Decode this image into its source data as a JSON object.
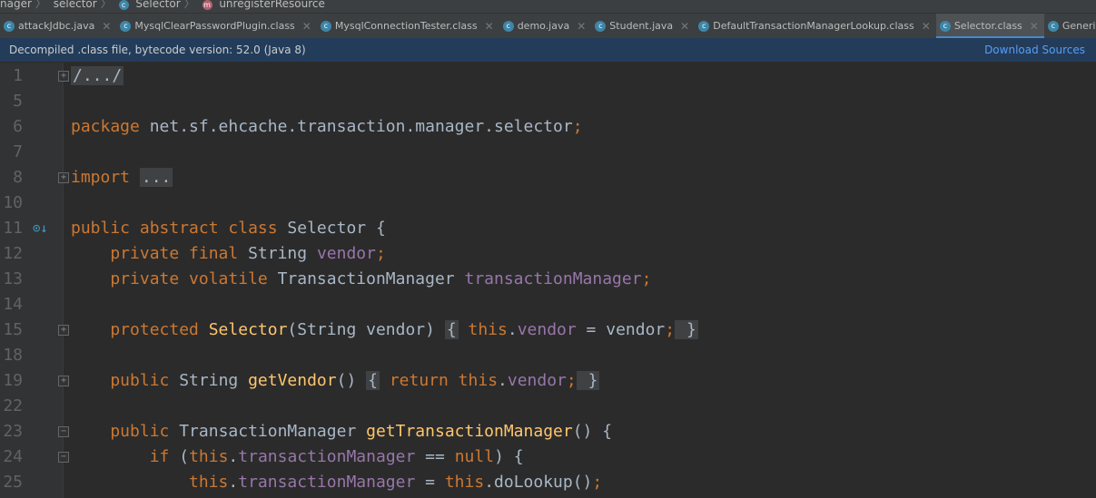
{
  "breadcrumbs": [
    "nager",
    "selector",
    "Selector",
    "unregisterResource"
  ],
  "tabs": [
    {
      "label": "attackJdbc.java",
      "active": false
    },
    {
      "label": "MysqlClearPasswordPlugin.class",
      "active": false
    },
    {
      "label": "MysqlConnectionTester.class",
      "active": false
    },
    {
      "label": "demo.java",
      "active": false
    },
    {
      "label": "Student.java",
      "active": false
    },
    {
      "label": "DefaultTransactionManagerLookup.class",
      "active": false
    },
    {
      "label": "Selector.class",
      "active": true
    },
    {
      "label": "GenericJndiSelector.class",
      "active": false
    }
  ],
  "banner": {
    "message": "Decompiled .class file, bytecode version: 52.0 (Java 8)",
    "action": "Download Sources"
  },
  "colors": {
    "keyword": "#cc7832",
    "field": "#9876aa",
    "method": "#ffc66d",
    "text": "#a9b7c6",
    "link": "#589df6"
  },
  "code": [
    {
      "n": "1",
      "fold": "+",
      "t": [
        [
          "fb",
          "/.../"
        ]
      ]
    },
    {
      "n": "5",
      "t": []
    },
    {
      "n": "6",
      "t": [
        [
          "kw",
          "package "
        ],
        [
          "",
          "net.sf.ehcache.transaction.manager.selector"
        ],
        [
          "kw",
          ";"
        ]
      ]
    },
    {
      "n": "7",
      "t": []
    },
    {
      "n": "8",
      "fold": "+",
      "t": [
        [
          "kw",
          "import "
        ],
        [
          "fb",
          "..."
        ]
      ]
    },
    {
      "n": "10",
      "t": []
    },
    {
      "n": "11",
      "icon": "implemented-by-icon",
      "t": [
        [
          "kw",
          "public abstract class "
        ],
        [
          "",
          "Selector {"
        ]
      ]
    },
    {
      "n": "12",
      "t": [
        [
          "kw",
          "    private final "
        ],
        [
          "",
          "String "
        ],
        [
          "fd",
          "vendor"
        ],
        [
          "kw",
          ";"
        ]
      ]
    },
    {
      "n": "13",
      "t": [
        [
          "kw",
          "    private volatile "
        ],
        [
          "",
          "TransactionManager "
        ],
        [
          "fd",
          "transactionManager"
        ],
        [
          "kw",
          ";"
        ]
      ]
    },
    {
      "n": "14",
      "t": []
    },
    {
      "n": "15",
      "fold": "+",
      "t": [
        [
          "kw",
          "    protected "
        ],
        [
          "md",
          "Selector"
        ],
        [
          "",
          "(String vendor) "
        ],
        [
          "fb",
          "{"
        ],
        [
          "kw",
          " this"
        ],
        [
          "",
          "."
        ],
        [
          "fd",
          "vendor"
        ],
        [
          "",
          " = vendor"
        ],
        [
          "kw",
          ";"
        ],
        [
          "fb",
          " }"
        ]
      ]
    },
    {
      "n": "18",
      "t": []
    },
    {
      "n": "19",
      "fold": "+",
      "t": [
        [
          "kw",
          "    public "
        ],
        [
          "",
          "String "
        ],
        [
          "md",
          "getVendor"
        ],
        [
          "",
          "() "
        ],
        [
          "fb",
          "{"
        ],
        [
          "kw",
          " return this"
        ],
        [
          "",
          "."
        ],
        [
          "fd",
          "vendor"
        ],
        [
          "kw",
          ";"
        ],
        [
          "fb",
          " }"
        ]
      ]
    },
    {
      "n": "22",
      "t": []
    },
    {
      "n": "23",
      "fold": "-",
      "t": [
        [
          "kw",
          "    public "
        ],
        [
          "",
          "TransactionManager "
        ],
        [
          "md",
          "getTransactionManager"
        ],
        [
          "",
          "() {"
        ]
      ]
    },
    {
      "n": "24",
      "fold": "-",
      "t": [
        [
          "kw",
          "        if "
        ],
        [
          "",
          "("
        ],
        [
          "kw",
          "this"
        ],
        [
          "",
          "."
        ],
        [
          "fd",
          "transactionManager"
        ],
        [
          "",
          " == "
        ],
        [
          "kw",
          "null"
        ],
        [
          "",
          ") {"
        ]
      ]
    },
    {
      "n": "25",
      "t": [
        [
          "kw",
          "            this"
        ],
        [
          "",
          "."
        ],
        [
          "fd",
          "transactionManager"
        ],
        [
          "",
          " = "
        ],
        [
          "kw",
          "this"
        ],
        [
          "",
          ".doLookup()"
        ],
        [
          "kw",
          ";"
        ]
      ]
    }
  ]
}
